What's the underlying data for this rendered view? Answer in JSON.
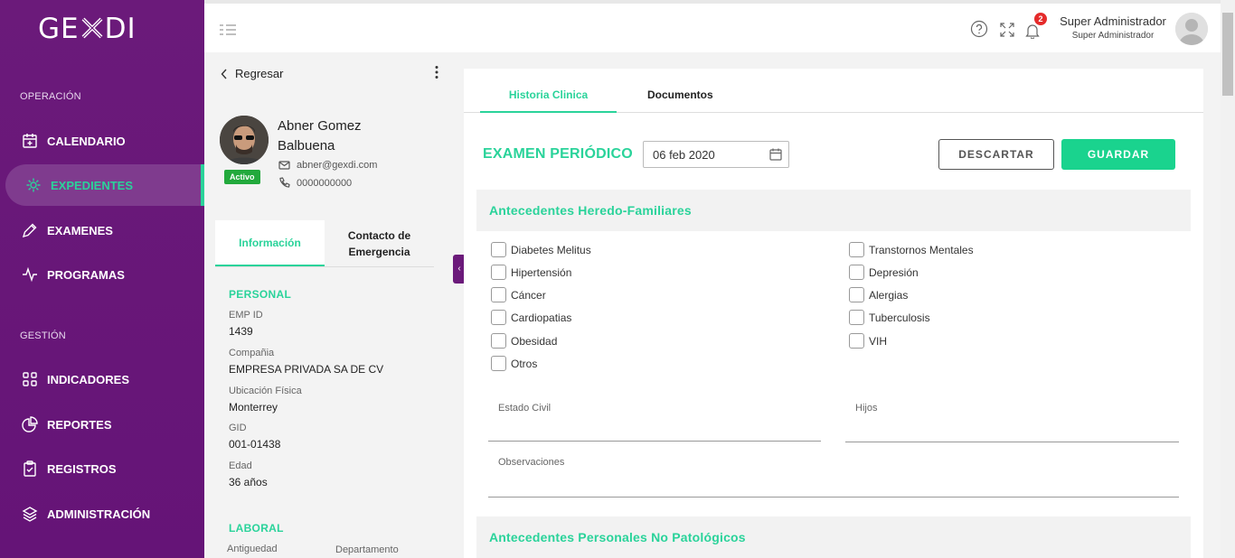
{
  "brand": {
    "logo_text_left": "GE",
    "logo_text_right": "DI"
  },
  "sidebar": {
    "section_operacion": "OPERACIÓN",
    "section_gestion": "GESTIÓN",
    "items": [
      {
        "label": "CALENDARIO",
        "icon": "calendar-icon"
      },
      {
        "label": "EXPEDIENTES",
        "icon": "gear-icon",
        "active": true
      },
      {
        "label": "EXAMENES",
        "icon": "pencil-icon"
      },
      {
        "label": "PROGRAMAS",
        "icon": "pulse-icon"
      },
      {
        "label": "INDICADORES",
        "icon": "grid-icon"
      },
      {
        "label": "REPORTES",
        "icon": "pie-chart-icon"
      },
      {
        "label": "REGISTROS",
        "icon": "clipboard-icon"
      },
      {
        "label": "ADMINISTRACIÓN",
        "icon": "layers-icon"
      }
    ]
  },
  "topbar": {
    "notifications": "2",
    "user_name": "Super Administrador",
    "user_role": "Super Administrador"
  },
  "profile": {
    "back_label": "Regresar",
    "name": "Abner Gomez Balbuena",
    "status": "Activo",
    "email": "abner@gexdi.com",
    "phone": "0000000000",
    "tabs": [
      "Información",
      "Contacto de Emergencia"
    ],
    "personal_heading": "PERSONAL",
    "fields": [
      {
        "label": "EMP ID",
        "value": "1439"
      },
      {
        "label": "Compañia",
        "value": "EMPRESA PRIVADA SA DE CV"
      },
      {
        "label": "Ubicación Física",
        "value": "Monterrey"
      },
      {
        "label": "GID",
        "value": "001-01438"
      },
      {
        "label": "Edad",
        "value": "36 años"
      }
    ],
    "laboral_heading": "LABORAL",
    "laboral_fields": [
      "Antiguedad",
      "Departamento"
    ]
  },
  "main": {
    "tabs": [
      "Historia Clinica",
      "Documentos"
    ],
    "exam_title": "EXAMEN PERIÓDICO",
    "date": "06 feb 2020",
    "discard_label": "DESCARTAR",
    "save_label": "GUARDAR",
    "section1": "Antecedentes Heredo-Familiares",
    "checks_left": [
      "Diabetes Melitus",
      "Hipertensión",
      "Cáncer",
      "Cardiopatias",
      "Obesidad",
      "Otros"
    ],
    "checks_right": [
      "Transtornos Mentales",
      "Depresión",
      "Alergias",
      "Tuberculosis",
      "VIH"
    ],
    "estado_civil": "Estado Civil",
    "hijos": "Hijos",
    "observaciones": "Observaciones",
    "section2": "Antecedentes Personales No Patológicos"
  },
  "colors": {
    "sidebar": "#6b1a7a",
    "accent": "#2ad39a",
    "save": "#1ad38e",
    "badge": "#e52b2b",
    "activo": "#22a93c"
  }
}
